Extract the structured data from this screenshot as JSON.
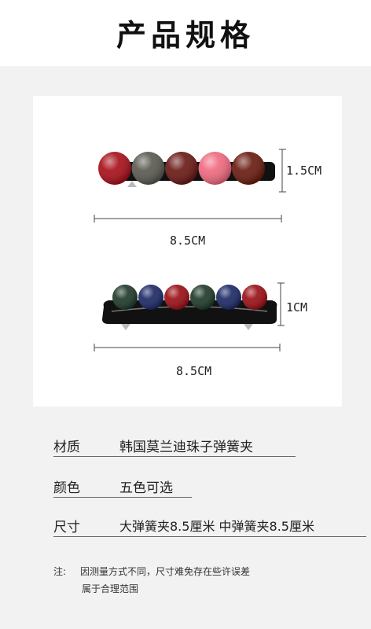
{
  "header": {
    "title": "产品规格"
  },
  "photo": {
    "top_clip": {
      "height_label": "1.5CM",
      "length_label": "8.5CM",
      "bead_colors": [
        "#a8101a",
        "#5a5a52",
        "#6a1a16",
        "#f06a80",
        "#6a1c10"
      ]
    },
    "bottom_clip": {
      "height_label": "1CM",
      "length_label": "8.5CM",
      "bead_colors": [
        "#1f3a2a",
        "#1c2a66",
        "#9a1016",
        "#1f3a2a",
        "#1c2a66",
        "#9a1016"
      ]
    }
  },
  "specs": [
    {
      "label": "材质",
      "value": "韩国莫兰迪珠子弹簧夹"
    },
    {
      "label": "颜色",
      "value": "五色可选"
    },
    {
      "label": "尺寸",
      "value": "大弹簧夹8.5厘米 中弹簧夹8.5厘米"
    }
  ],
  "note": {
    "label": "注:",
    "line1": "因测量方式不同，尺寸难免存在些许误差",
    "line2": "属于合理范围"
  }
}
